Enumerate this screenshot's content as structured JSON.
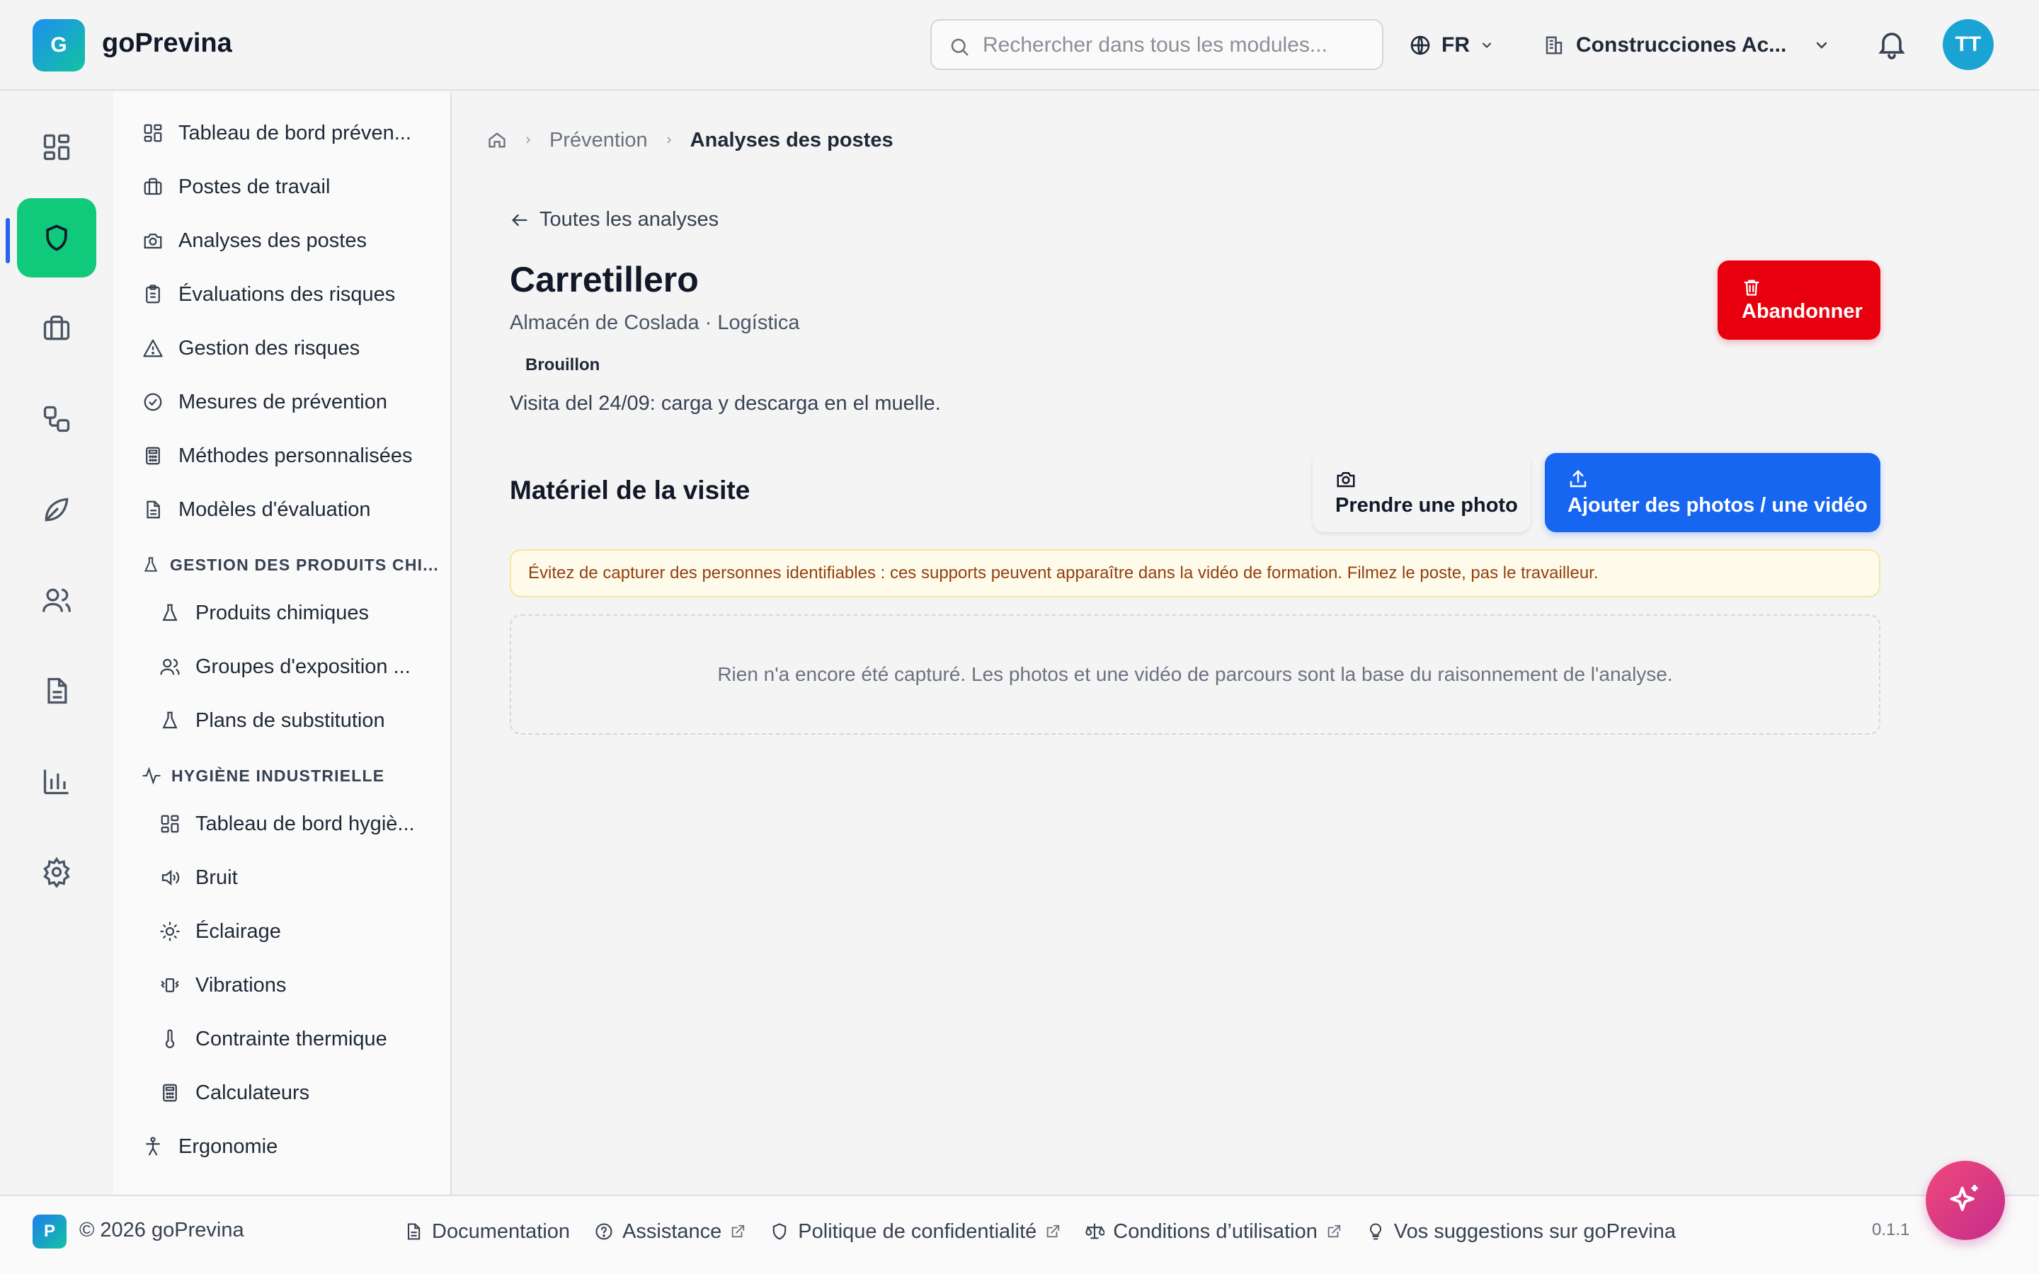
{
  "app": {
    "logo_letter": "G",
    "name": "goPrevina"
  },
  "header": {
    "search_placeholder": "Rechercher dans tous les modules...",
    "language": "FR",
    "company": "Construcciones Ac...",
    "user_initials": "TT"
  },
  "sidebar": {
    "items": [
      {
        "label": "Tableau de bord préven...",
        "icon": "dashboard-icon"
      },
      {
        "label": "Postes de travail",
        "icon": "briefcase-icon"
      },
      {
        "label": "Analyses des postes",
        "icon": "camera-icon"
      },
      {
        "label": "Évaluations des risques",
        "icon": "clipboard-icon"
      },
      {
        "label": "Gestion des risques",
        "icon": "warning-icon"
      },
      {
        "label": "Mesures de prévention",
        "icon": "check-circle-icon"
      },
      {
        "label": "Méthodes personnalisées",
        "icon": "calculator-icon"
      },
      {
        "label": "Modèles d'évaluation",
        "icon": "document-icon"
      }
    ],
    "section_chem": "GESTION DES PRODUITS CHI...",
    "chem_items": [
      {
        "label": "Produits chimiques",
        "icon": "flask-icon"
      },
      {
        "label": "Groupes d'exposition ...",
        "icon": "users-icon"
      },
      {
        "label": "Plans de substitution",
        "icon": "flask-icon"
      }
    ],
    "section_hyg": "HYGIÈNE INDUSTRIELLE",
    "hyg_items": [
      {
        "label": "Tableau de bord hygiè...",
        "icon": "dashboard-icon"
      },
      {
        "label": "Bruit",
        "icon": "speaker-icon"
      },
      {
        "label": "Éclairage",
        "icon": "sun-icon"
      },
      {
        "label": "Vibrations",
        "icon": "vibration-icon"
      },
      {
        "label": "Contrainte thermique",
        "icon": "thermometer-icon"
      },
      {
        "label": "Calculateurs",
        "icon": "calculator-icon"
      }
    ],
    "ergonomie": "Ergonomie"
  },
  "breadcrumb": {
    "parent": "Prévention",
    "current": "Analyses des postes"
  },
  "page": {
    "back_label": "Toutes les analyses",
    "title": "Carretillero",
    "subtitle": "Almacén de Coslada · Logística",
    "status": "Brouillon",
    "description": "Visita del 24/09: carga y descarga en el muelle.",
    "abandon_label": "Abandonner",
    "section_title": "Matériel de la visite",
    "photo_label": "Prendre une photo",
    "upload_label": "Ajouter des photos / une vidéo",
    "warning": "Évitez de capturer des personnes identifiables : ces supports peuvent apparaître dans la vidéo de formation. Filmez le poste, pas le travailleur.",
    "empty": "Rien n'a encore été capturé. Les photos et une vidéo de parcours sont la base du raisonnement de l'analyse."
  },
  "footer": {
    "logo_letter": "P",
    "copyright": "© 2026 goPrevina",
    "documentation": "Documentation",
    "assistance": "Assistance",
    "privacy": "Politique de confidentialité",
    "terms": "Conditions d’utilisation",
    "suggestions": "Vos suggestions sur goPrevina",
    "version": "0.1.1"
  },
  "colors": {
    "accent_green": "#10c97a",
    "primary_blue": "#1766f2",
    "danger_red": "#e8000f",
    "warning_bg": "#fffbeb"
  }
}
